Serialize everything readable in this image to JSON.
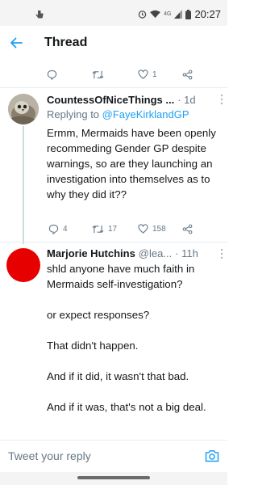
{
  "status_bar": {
    "time": "20:27",
    "network": "4G",
    "icons": [
      "touch-notification-icon",
      "alarm-icon",
      "wifi-icon",
      "signal-icon",
      "battery-icon"
    ]
  },
  "header": {
    "title": "Thread",
    "back_icon": "arrow-left-icon"
  },
  "previous_tweet": {
    "like_count": "1"
  },
  "tweet1": {
    "name": "CountessOfNiceThings ...",
    "time": "· 1d",
    "reply_prefix": "Replying to ",
    "reply_mention": "@FayeKirklandGP",
    "text": "Ermm, Mermaids have been openly recommeding Gender GP despite warnings, so are they launching an investigation into themselves as to why they did it??",
    "replies": "4",
    "retweets": "17",
    "likes": "158"
  },
  "tweet2": {
    "name": "Marjorie Hutchins",
    "handle": "@lea...",
    "time": "· 11h",
    "paragraphs": [
      "shld anyone have much faith in Mermaids self-investigation?",
      "or expect responses?",
      "That didn't happen.",
      "And if it did, it wasn't that bad.",
      "And if it was, that's not a big deal."
    ]
  },
  "compose": {
    "placeholder": "Tweet your reply",
    "camera_icon": "camera-icon"
  },
  "colors": {
    "accent": "#1da1f2",
    "secondary_text": "#657786",
    "avatar2": "#e60000"
  }
}
